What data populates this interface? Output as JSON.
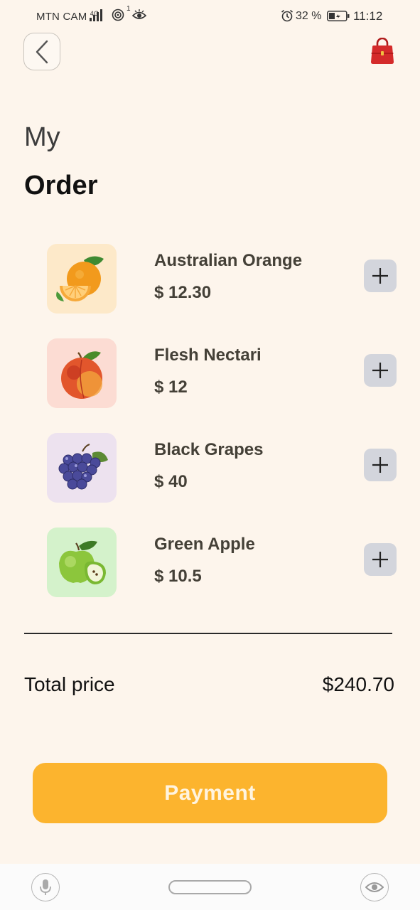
{
  "status_bar": {
    "carrier": "MTN CAM",
    "network": "4G",
    "hotspot_count": "1",
    "battery_percent": "32 %",
    "time": "11:12"
  },
  "header": {
    "back_icon": "chevron-left-icon",
    "cart_icon": "shopping-bag-icon"
  },
  "title": {
    "line1": "My",
    "line2": "Order"
  },
  "items": [
    {
      "name": "Australian Orange",
      "price": "$ 12.30",
      "icon": "orange-icon",
      "bg": "#fde9c9"
    },
    {
      "name": "Flesh Nectari",
      "price": "$ 12",
      "icon": "peach-icon",
      "bg": "#fcdcd3"
    },
    {
      "name": "Black Grapes",
      "price": "$ 40",
      "icon": "grapes-icon",
      "bg": "#ede2ef"
    },
    {
      "name": "Green Apple",
      "price": "$ 10.5",
      "icon": "apple-icon",
      "bg": "#d4f2cb"
    }
  ],
  "total": {
    "label": "Total price",
    "value": "$240.70"
  },
  "payment": {
    "label": "Payment"
  },
  "colors": {
    "background": "#fdf5ec",
    "accent": "#fcb42e",
    "add_button": "#d3d5dc",
    "bag": "#d42a2a"
  }
}
